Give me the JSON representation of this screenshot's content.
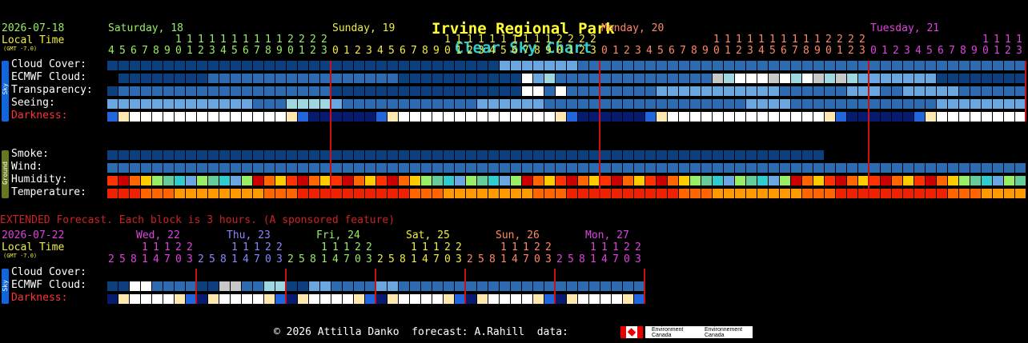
{
  "header": {
    "title_place": "Irvine Regional Park",
    "title_chart": "Clear Sky Chart"
  },
  "main": {
    "date": "2026-07-18",
    "local_time": "Local Time",
    "gmt": "(GMT -7.0)",
    "days": [
      {
        "label": "Saturday, 18",
        "color": "#99ee66"
      },
      {
        "label": "Sunday, 19",
        "color": "#eeee44"
      },
      {
        "label": "Monday, 20",
        "color": "#ff8866"
      },
      {
        "label": "Tuesday, 21",
        "color": "#dd44dd"
      }
    ],
    "hours_row1": "11111112222  11111111112222  11111111112222  111111111112222",
    "hours_row2": "4567890123012345678901234567890123456789012345678901234567890123",
    "sky_side": "Sky",
    "ground_side": "Ground",
    "rows": {
      "cloud": "Cloud Cover:",
      "ecmwf": "ECMWF Cloud:",
      "transparency": "Transparency:",
      "seeing": "Seeing:",
      "darkness": "Darkness:",
      "smoke": "Smoke:",
      "wind": "Wind:",
      "humidity": "Humidity:",
      "temperature": "Temperature:"
    }
  },
  "extended": {
    "banner": "EXTENDED Forecast. Each block is 3 hours. (A sponsored feature)",
    "date": "2026-07-22",
    "local_time": "Local Time",
    "gmt": "(GMT -7.0)",
    "days": [
      {
        "label": "Wed, 22",
        "color": "#dd44dd"
      },
      {
        "label": "Thu, 23",
        "color": "#8888ff"
      },
      {
        "label": "Fri, 24",
        "color": "#99ee66"
      },
      {
        "label": "Sat, 25",
        "color": "#eeee44"
      },
      {
        "label": "Sun, 26",
        "color": "#ff8866"
      },
      {
        "label": "Mon, 27",
        "color": "#dd44dd"
      }
    ],
    "hours_row1": " 11122",
    "hours_row2": "25814703",
    "sky_side": "Sky",
    "rows": {
      "cloud": "Cloud Cover:",
      "ecmwf": "ECMWF Cloud:",
      "darkness": "Darkness:"
    }
  },
  "footer": {
    "copyright": "© 2026 Attilla Danko  forecast: A.Rahill  data:",
    "logo_text_1": "Environment Canada",
    "logo_text_2": "Environnement Canada"
  },
  "colors": {
    "sky_sidebar": "#1166dd",
    "ground_sidebar": "#667722",
    "divider": "#cc1111",
    "cloud_dark": "#0b3f7e",
    "cloud_mid": "#2d6bb0",
    "cloud_light": "#6aa6e0",
    "darkness_label": "#ff3333",
    "banner": "#cc2222",
    "local_time": "#eeee44"
  }
}
